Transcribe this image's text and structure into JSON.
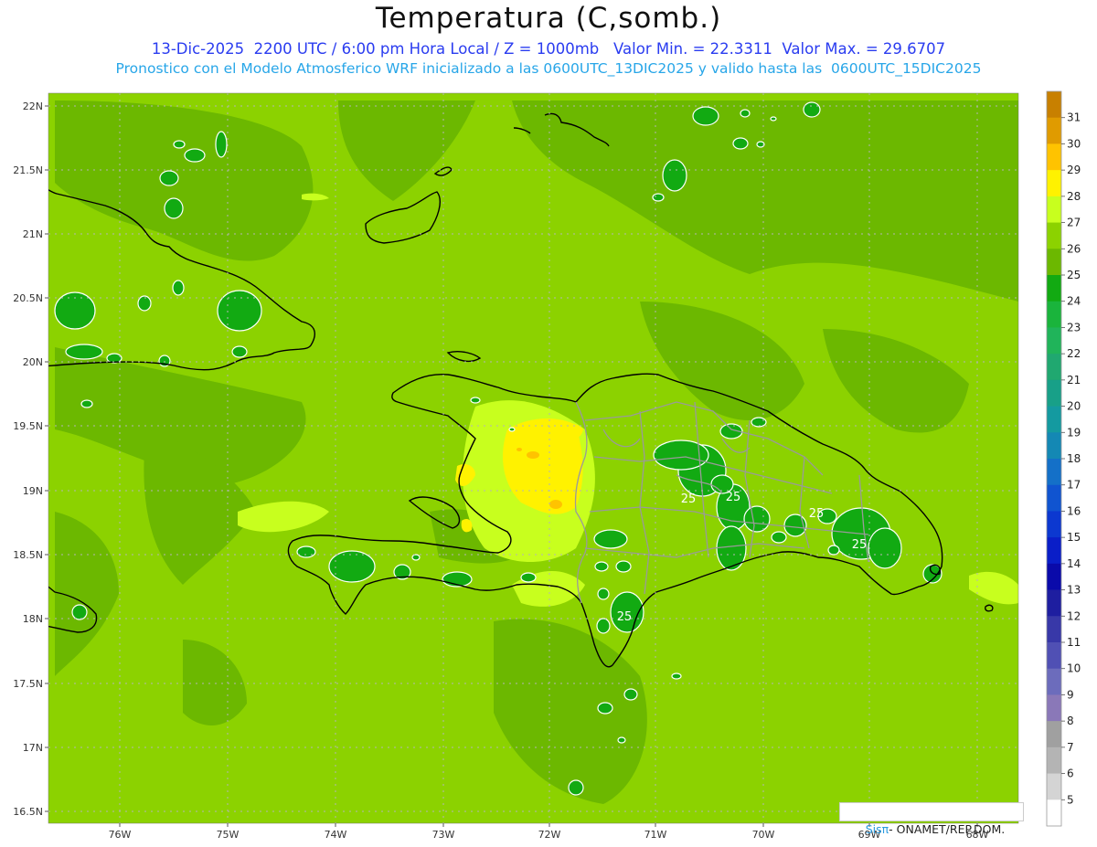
{
  "header": {
    "title": "Temperatura (C,somb.)",
    "subtitle_1": "13-Dic-2025  2200 UTC / 6:00 pm Hora Local / Z = 1000mb   Valor Min. = 22.3311  Valor Max. = 29.6707",
    "subtitle_2": "Pronostico con el Modelo Atmosferico WRF inicializado a las 0600UTC_13DIC2025 y valido hasta las  0600UTC_15DIC2025"
  },
  "axes": {
    "lat_labels": [
      "22N",
      "21.5N",
      "21N",
      "20.5N",
      "20N",
      "19.5N",
      "19N",
      "18.5N",
      "18N",
      "17.5N",
      "17N",
      "16.5N"
    ],
    "lon_labels": [
      "76W",
      "75W",
      "74W",
      "73W",
      "72W",
      "71W",
      "70W",
      "69W",
      "68W"
    ]
  },
  "colorbar": {
    "labels": [
      "31",
      "30",
      "29",
      "28",
      "27",
      "26",
      "25",
      "24",
      "23",
      "22",
      "21",
      "20",
      "19",
      "18",
      "17",
      "16",
      "15",
      "14",
      "13",
      "12",
      "11",
      "10",
      "9",
      "8",
      "7",
      "6",
      "5"
    ],
    "colors": [
      "#c88000",
      "#e09b00",
      "#ffc300",
      "#fff200",
      "#c8ff1e",
      "#8cd200",
      "#6cb800",
      "#12aa12",
      "#1ab43c",
      "#20b45a",
      "#20a870",
      "#18a088",
      "#149aa0",
      "#1488b4",
      "#1470c8",
      "#1054d0",
      "#0c38d0",
      "#0a1ec8",
      "#0a0aaa",
      "#1e1ea0",
      "#3838a8",
      "#5050b4",
      "#6c6cbc",
      "#8a78b8",
      "#a0a0a0",
      "#b4b4b4",
      "#d4d4d4",
      "#ffffff"
    ]
  },
  "map": {
    "contour_labels": [
      "25",
      "25",
      "25",
      "25",
      "25"
    ],
    "palette": {
      "base": "#8cd200",
      "t26": "#6cb800",
      "t24": "#12aa12",
      "t27": "#c8ff1e",
      "t28": "#fff200",
      "t29": "#ffc300"
    }
  },
  "credit": {
    "brand": "SisPi",
    "text": "- ONAMET/REP.DOM."
  }
}
